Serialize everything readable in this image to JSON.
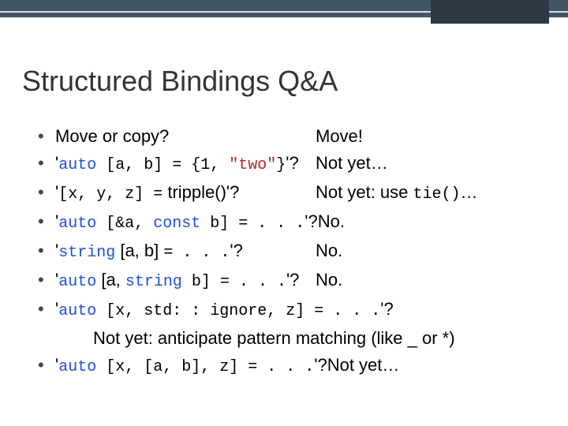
{
  "title": "Structured Bindings Q&A",
  "items": [
    {
      "q_html": "Move or copy?",
      "a": "Move!"
    },
    {
      "q_html": "'<span class=\"code\"><span class=\"kw\">auto</span> [a, b] = {1, <span class=\"str\">\"two\"</span>}</span>'?",
      "a": "Not yet…"
    },
    {
      "q_html": "'<span class=\"code\">[x, y, z] =</span> tripple()'?",
      "a_html": "Not yet: use <span class=\"code\">tie()</span>…"
    },
    {
      "q_html": "'<span class=\"code\"><span class=\"kw\">auto</span> [&amp;a, <span class=\"kw\">const</span> b] = . . .</span>'?",
      "a": "No."
    },
    {
      "q_html": "'<span class=\"code\"><span class=\"kw\">string</span></span> [a, b] <span class=\"code\">= . . .</span>'?",
      "a": "No."
    },
    {
      "q_html": "'<span class=\"code\"><span class=\"kw\">auto</span></span> [a, <span class=\"code\"><span class=\"kw\">string</span> b] = . . .</span>'?",
      "a": "No."
    },
    {
      "q_html": "'<span class=\"code\"><span class=\"kw\">auto</span> [x, std: : ignore, z] = . . .</span>'?",
      "a": "",
      "sub": "Not yet: anticipate pattern matching (like _ or *)"
    },
    {
      "q_html": "'<span class=\"code\"><span class=\"kw\">auto</span> [x, [a, b], z] = . . .</span>'?",
      "a": "Not yet…"
    }
  ]
}
